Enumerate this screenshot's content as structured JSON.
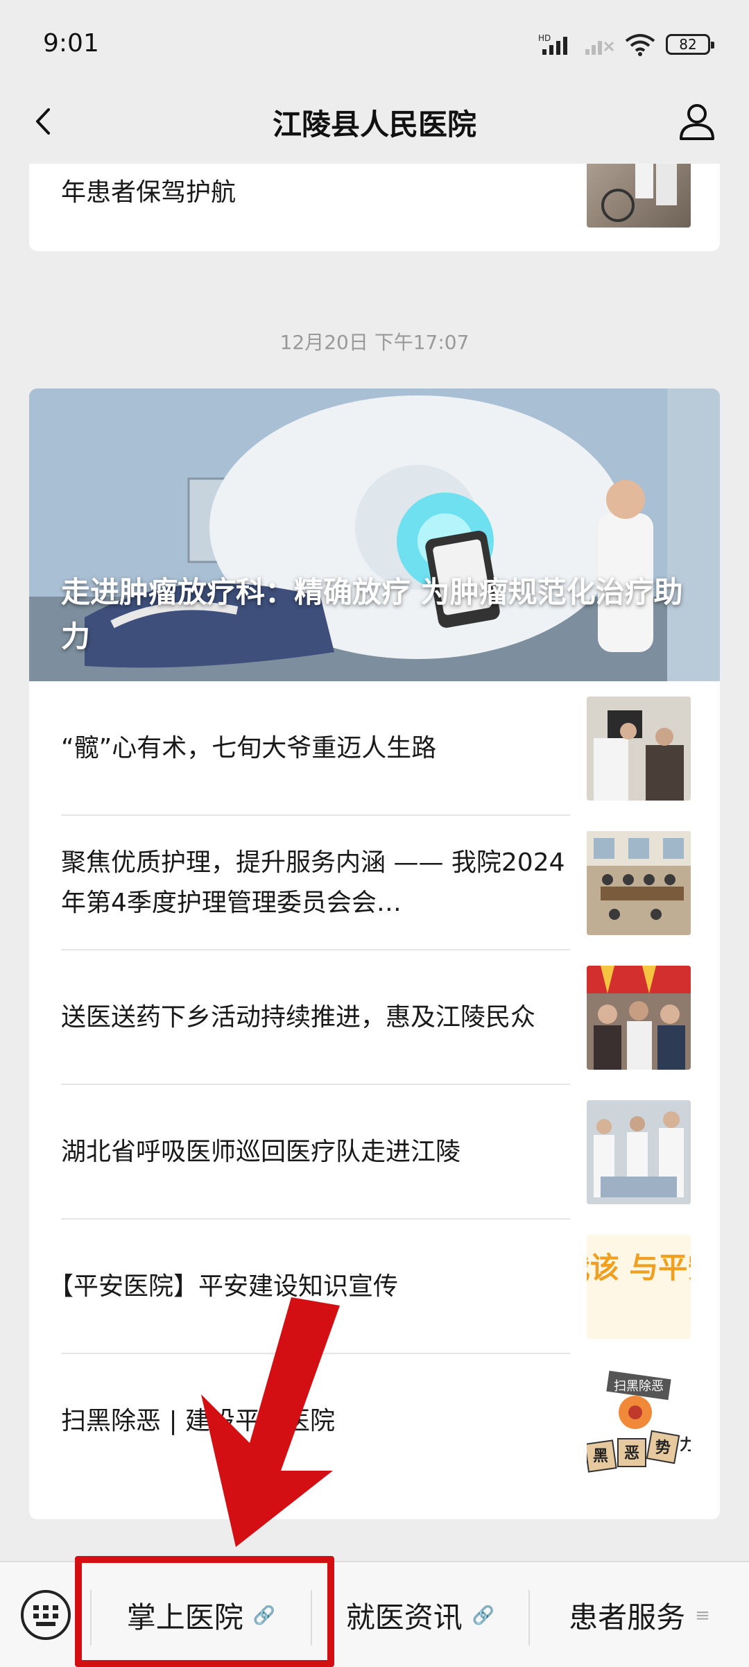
{
  "status_bar": {
    "time": "9:01",
    "battery": "82",
    "icons": [
      "hd-signal-icon",
      "no-signal-icon",
      "wifi-icon",
      "battery-icon"
    ]
  },
  "nav": {
    "title": "江陵县人民医院",
    "back_icon": "chevron-left-icon",
    "profile_icon": "person-icon"
  },
  "top_card": {
    "text": "年患者保驾护航"
  },
  "timestamp": "12月20日 下午17:07",
  "main_card": {
    "hero_title": "走进肿瘤放疗科：精确放疗 为肿瘤规范化治疗助力",
    "items": [
      {
        "text": "“髋”心有术，七旬大爷重迈人生路"
      },
      {
        "text": "聚焦优质护理，提升服务内涵 —— 我院2024年第4季度护理管理委员会会…"
      },
      {
        "text": "送医送药下乡活动持续推进，惠及江陵民众"
      },
      {
        "text": "湖北省呼吸医师巡回医疗队走进江陵"
      },
      {
        "text": "【平安医院】平安建设知识宣传"
      },
      {
        "text": "扫黑除恶 | 建设平安医院"
      }
    ],
    "thumb_texts": {
      "safe_hospital": "你我该\n与平安建",
      "anti_crime_sign": "扫黑除恶",
      "anti_crime_words": [
        "黑",
        "恶",
        "势",
        "力"
      ]
    }
  },
  "bottom_menu": {
    "items": [
      {
        "label": "掌上医院",
        "icon": "link-icon"
      },
      {
        "label": "就医资讯",
        "icon": "link-icon"
      },
      {
        "label": "患者服务",
        "icon": "menu-lines-icon"
      }
    ],
    "keyboard_icon": "keyboard-icon"
  },
  "colors": {
    "highlight": "#d40f14",
    "background": "#ededed",
    "card": "#ffffff"
  }
}
